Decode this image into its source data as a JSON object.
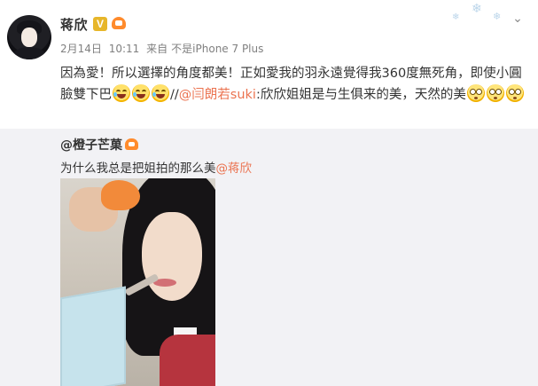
{
  "post": {
    "username": "蒋欣",
    "verified_badge": "V",
    "date": "2月14日",
    "time": "10:11",
    "source_prefix": "来自",
    "source": "不是iPhone 7 Plus",
    "text_line1": "因為愛！所以選擇的角度都美！正如愛我的羽永遠覺得我360度無死角，即使小",
    "text_line2_part1": "圓臉雙下巴",
    "text_line2_sep": "//",
    "text_line2_mention": "@闫朗若suki",
    "text_line2_part2": ":欣欣姐姐是与生俱来的美，天然的美"
  },
  "repost": {
    "username": "@橙子芒菓",
    "text": "为什么我总是把姐拍的那么美",
    "mention": "@蒋欣"
  },
  "icons": {
    "verified": "verified-icon",
    "vip": "vip-crown-icon",
    "menu": "chevron-down-icon",
    "emoji_laugh": "laugh-cry-emoji",
    "emoji_wow": "shocked-emoji"
  },
  "colors": {
    "mention": "#eb7350",
    "repost_bg": "#f2f2f5",
    "verified": "#e7b62a",
    "vip": "#ff8b2c"
  }
}
